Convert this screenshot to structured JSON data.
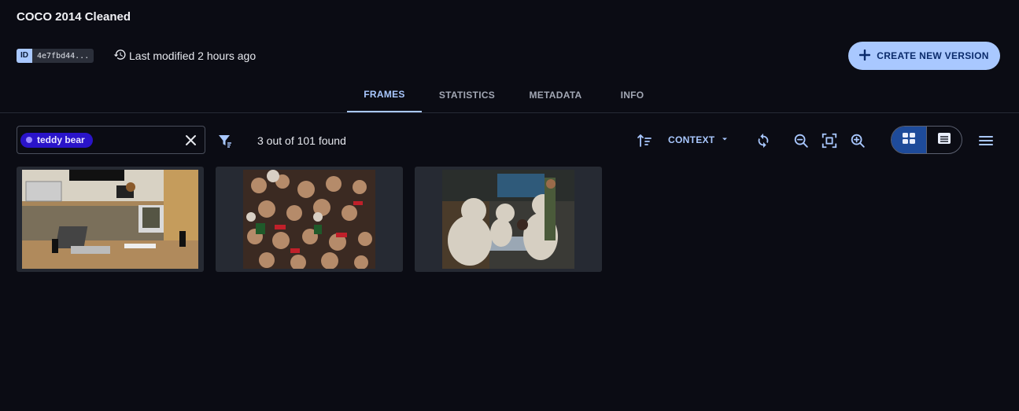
{
  "header": {
    "title": "COCO 2014 Cleaned",
    "id_label": "ID",
    "id_value": "4e7fbd44...",
    "last_modified": "Last modified 2 hours ago",
    "create_button": "CREATE NEW VERSION"
  },
  "tabs": [
    {
      "label": "FRAMES",
      "active": true
    },
    {
      "label": "STATISTICS",
      "active": false
    },
    {
      "label": "METADATA",
      "active": false
    },
    {
      "label": "INFO",
      "active": false
    }
  ],
  "toolbar": {
    "filter_tag": "teddy bear",
    "results_text": "3 out of 101 found",
    "context_label": "CONTEXT",
    "view_mode": "grid"
  },
  "frames": [
    {
      "description": "desk with laptop and teddy bear"
    },
    {
      "description": "pile of teddy bears"
    },
    {
      "description": "large teddy bears in store"
    }
  ],
  "colors": {
    "background": "#0b0c14",
    "accent": "#a9c8ff",
    "tag": "#2a14c9",
    "card": "#262a33"
  }
}
